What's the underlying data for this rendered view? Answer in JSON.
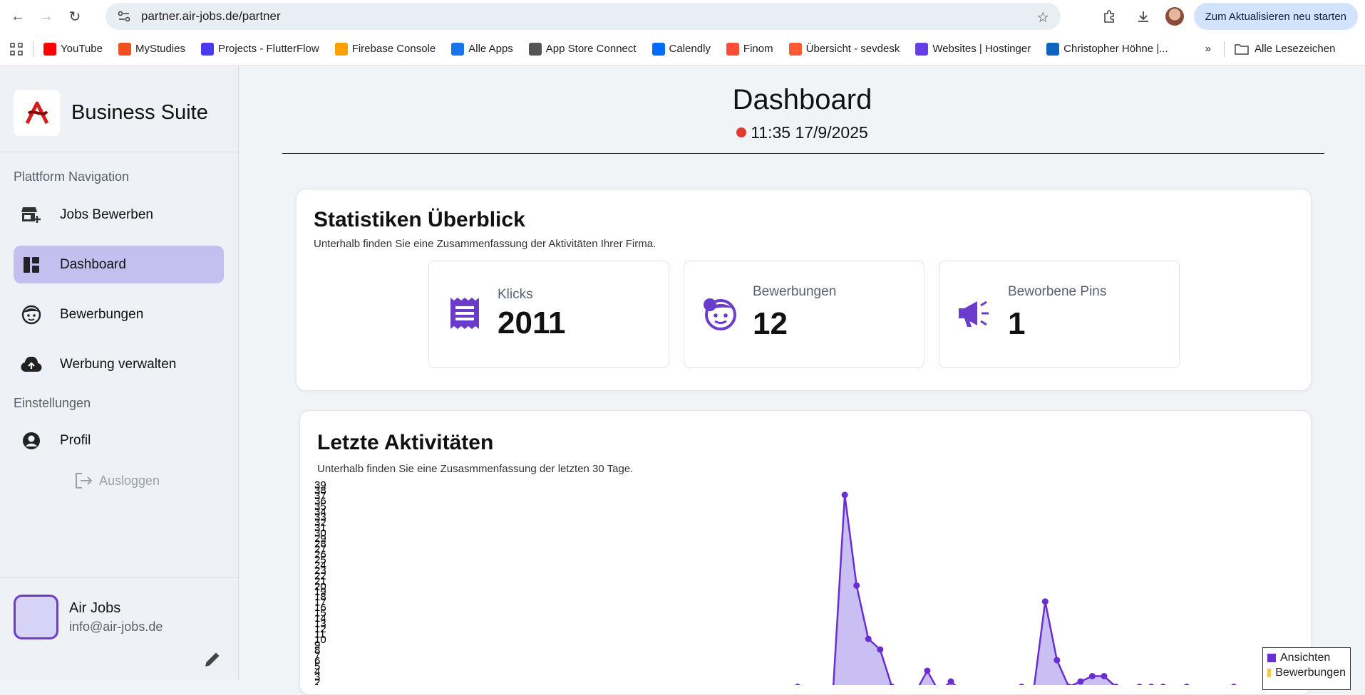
{
  "browser": {
    "url": "partner.air-jobs.de/partner",
    "update_label": "Zum Aktualisieren neu starten",
    "bookmarks": [
      {
        "label": "YouTube",
        "icon": "youtube-icon",
        "color": "#ff0000"
      },
      {
        "label": "MyStudies",
        "icon": "microsoft-icon",
        "color": "#f25022"
      },
      {
        "label": "Projects - FlutterFlow",
        "icon": "flutterflow-icon",
        "color": "#4b39ef"
      },
      {
        "label": "Firebase Console",
        "icon": "firebase-icon",
        "color": "#ffa000"
      },
      {
        "label": "Alle Apps",
        "icon": "play-icon",
        "color": "#1a73e8"
      },
      {
        "label": "App Store Connect",
        "icon": "apple-icon",
        "color": "#555555"
      },
      {
        "label": "Calendly",
        "icon": "calendly-icon",
        "color": "#006bff"
      },
      {
        "label": "Finom",
        "icon": "finom-icon",
        "color": "#ff4d3a"
      },
      {
        "label": "Übersicht - sevdesk",
        "icon": "sevdesk-icon",
        "color": "#ff5a36"
      },
      {
        "label": "Websites | Hostinger",
        "icon": "hostinger-icon",
        "color": "#673de6"
      },
      {
        "label": "Christopher Höhne |...",
        "icon": "linkedin-icon",
        "color": "#0a66c2"
      }
    ],
    "all_bookmarks_label": "Alle Lesezeichen"
  },
  "sidebar": {
    "brand": "Business Suite",
    "nav_section": "Plattform Navigation",
    "items": [
      {
        "label": "Jobs Bewerben",
        "icon": "store-add-icon"
      },
      {
        "label": "Dashboard",
        "icon": "dashboard-icon"
      },
      {
        "label": "Bewerbungen",
        "icon": "face-icon"
      },
      {
        "label": "Werbung verwalten",
        "icon": "cloud-upload-icon"
      }
    ],
    "settings_section": "Einstellungen",
    "profile_label": "Profil",
    "logout_label": "Ausloggen",
    "user": {
      "name": "Air Jobs",
      "email": "info@air-jobs.de"
    }
  },
  "header": {
    "title": "Dashboard",
    "time": "11:35 17/9/2025"
  },
  "stats_card": {
    "title": "Statistiken Überblick",
    "subtitle": "Unterhalb finden Sie eine Zusammenfassung der Aktivitäten Ihrer Firma.",
    "stats": [
      {
        "label": "Klicks",
        "value": "2011"
      },
      {
        "label": "Bewerbungen",
        "value": "12"
      },
      {
        "label": "Beworbene Pins",
        "value": "1"
      }
    ]
  },
  "activity_card": {
    "title": "Letzte Aktivitäten",
    "subtitle": "Unterhalb finden Sie eine Zusasmmenfassung der letzten 30 Tage."
  },
  "chart_data": {
    "type": "area",
    "ylim": [
      0,
      39
    ],
    "ytick_top": "39",
    "grid": false,
    "legend_position": "bottom-right",
    "series": [
      {
        "name": "Ansichten",
        "color": "#6a2fd0",
        "values": [
          1,
          0,
          0,
          0,
          37,
          20,
          10,
          8,
          1,
          0,
          0,
          4,
          0,
          2,
          0,
          0,
          0,
          0,
          0,
          1,
          0,
          17,
          6,
          1,
          2,
          3,
          3,
          1,
          0,
          1,
          1,
          1,
          0,
          1,
          0,
          0,
          0,
          1,
          0,
          0
        ]
      },
      {
        "name": "Bewerbungen",
        "color": "#f2c94c",
        "values": [
          0,
          0,
          0,
          0,
          0,
          0,
          0,
          0,
          0,
          0,
          0,
          0,
          0,
          0,
          0,
          0,
          0,
          0,
          0,
          0,
          0,
          0,
          0,
          0,
          0,
          0,
          0,
          0,
          0,
          0,
          0,
          0,
          0,
          0,
          0,
          0,
          0,
          0,
          0,
          0
        ]
      }
    ]
  }
}
